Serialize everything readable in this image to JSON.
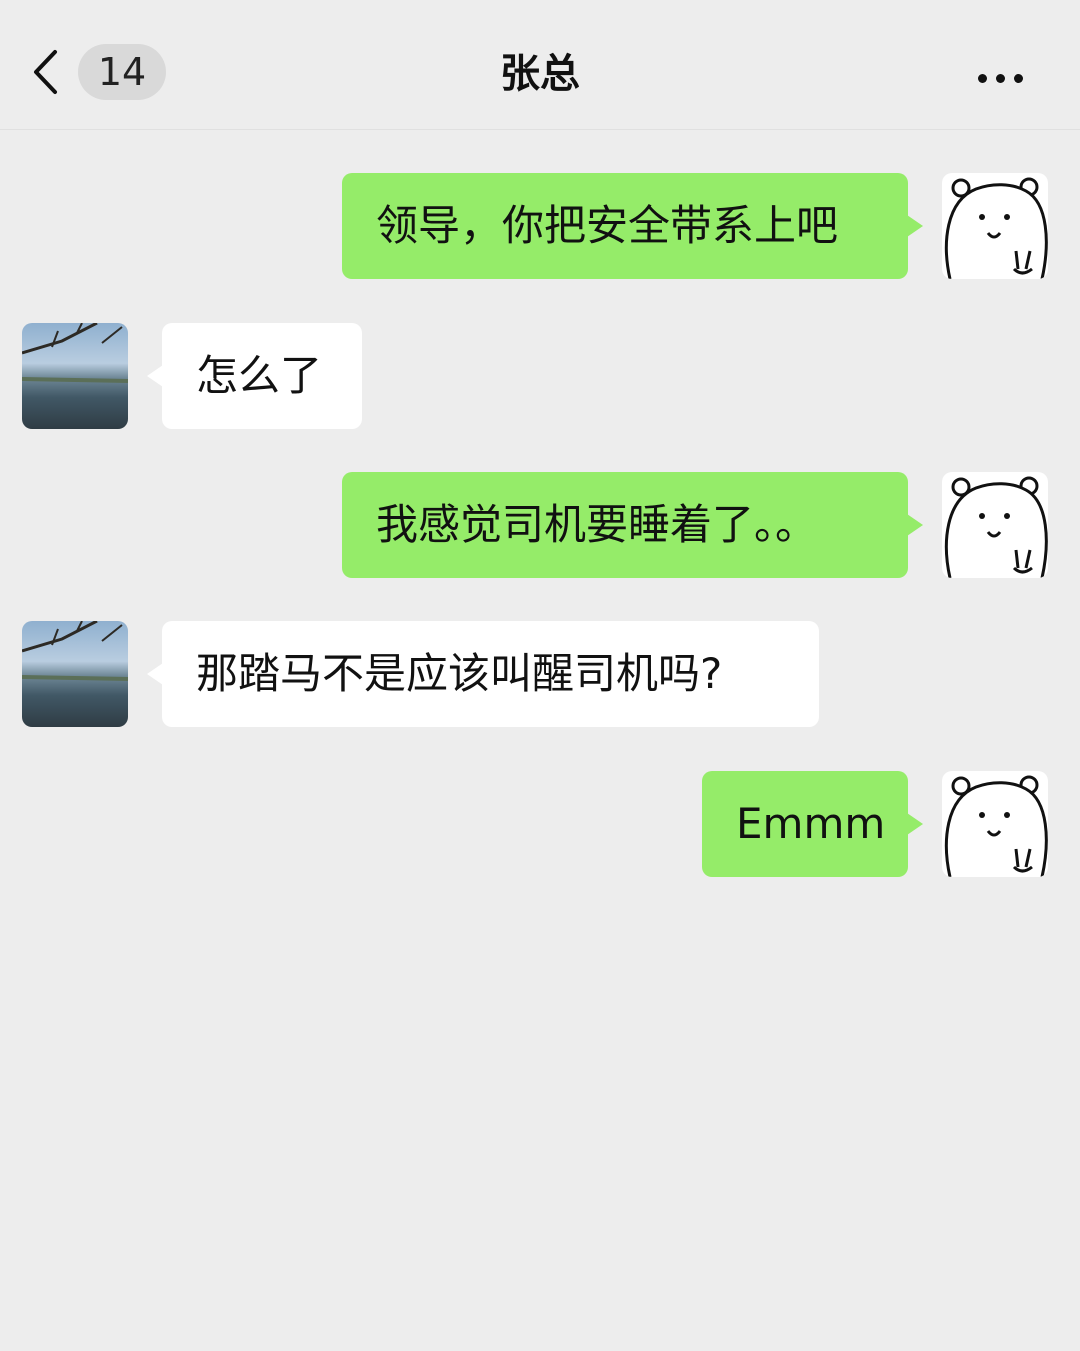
{
  "header": {
    "unread_count": "14",
    "title": "张总"
  },
  "messages": [
    {
      "side": "out",
      "text": "领导，你把安全带系上吧"
    },
    {
      "side": "in",
      "text": "怎么了"
    },
    {
      "side": "out",
      "text": "我感觉司机要睡着了。。"
    },
    {
      "side": "in",
      "text": "那踏马不是应该叫醒司机吗?"
    },
    {
      "side": "out",
      "text": "Emmm"
    }
  ],
  "colors": {
    "background": "#ededed",
    "outgoing_bubble": "#95ec69",
    "incoming_bubble": "#ffffff"
  },
  "icons": {
    "back": "chevron-left-icon",
    "more": "more-dots-icon",
    "my_avatar": "bear-avatar-icon",
    "contact_avatar": "lake-photo-avatar"
  }
}
